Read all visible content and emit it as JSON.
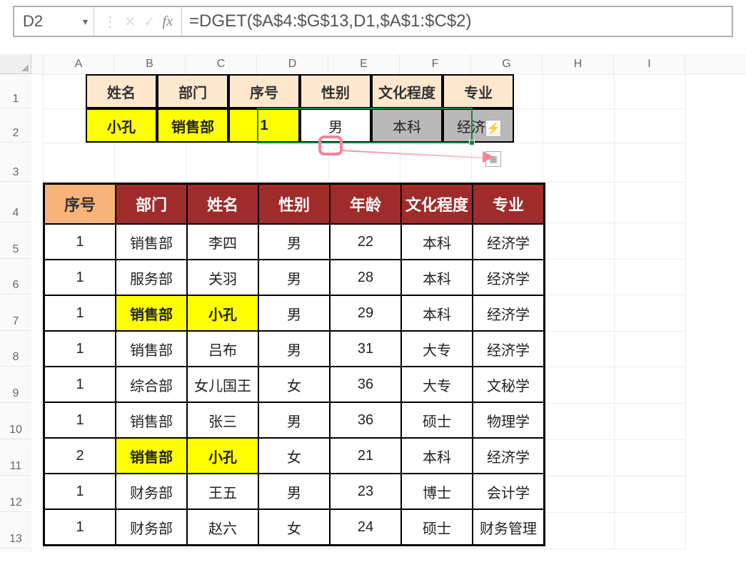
{
  "name_box": "D2",
  "formula": "=DGET($A$4:$G$13,D1,$A$1:$C$2)",
  "columns": [
    "A",
    "B",
    "C",
    "D",
    "E",
    "F",
    "G",
    "H",
    "I"
  ],
  "row_numbers": [
    1,
    2,
    3,
    4,
    5,
    6,
    7,
    8,
    9,
    10,
    11,
    12,
    13
  ],
  "criteria_headers": [
    "姓名",
    "部门",
    "序号",
    "性别",
    "文化程度",
    "专业"
  ],
  "criteria_values": [
    "小孔",
    "销售部",
    "1",
    "男",
    "本科",
    "经济学"
  ],
  "table": {
    "headers": [
      "序号",
      "部门",
      "姓名",
      "性别",
      "年龄",
      "文化程度",
      "专业"
    ],
    "rows": [
      [
        "1",
        "销售部",
        "李四",
        "男",
        "22",
        "本科",
        "经济学"
      ],
      [
        "1",
        "服务部",
        "关羽",
        "男",
        "28",
        "本科",
        "经济学"
      ],
      [
        "1",
        "销售部",
        "小孔",
        "男",
        "29",
        "本科",
        "经济学"
      ],
      [
        "1",
        "销售部",
        "吕布",
        "男",
        "31",
        "大专",
        "经济学"
      ],
      [
        "1",
        "综合部",
        "女儿国王",
        "女",
        "36",
        "大专",
        "文秘学"
      ],
      [
        "1",
        "销售部",
        "张三",
        "男",
        "36",
        "硕士",
        "物理学"
      ],
      [
        "2",
        "销售部",
        "小孔",
        "女",
        "21",
        "本科",
        "经济学"
      ],
      [
        "1",
        "财务部",
        "王五",
        "男",
        "23",
        "博士",
        "会计学"
      ],
      [
        "1",
        "财务部",
        "赵六",
        "女",
        "24",
        "硕士",
        "财务管理"
      ]
    ],
    "highlight_rows_cols": [
      {
        "row": 2,
        "cols": [
          1,
          2
        ]
      },
      {
        "row": 6,
        "cols": [
          1,
          2
        ]
      }
    ]
  },
  "icons": {
    "flash": "⚡"
  }
}
